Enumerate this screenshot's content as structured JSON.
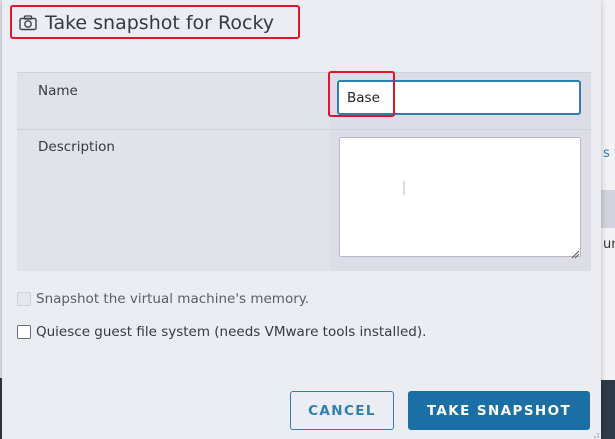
{
  "dialog": {
    "title": "Take snapshot for Rocky",
    "title_icon": "camera-icon"
  },
  "form": {
    "name_label": "Name",
    "name_value": "Base",
    "description_label": "Description",
    "description_value": ""
  },
  "options": {
    "memory_label": "Snapshot the virtual machine's memory.",
    "memory_checked": false,
    "memory_disabled": true,
    "quiesce_label": "Quiesce guest file system (needs VMware tools installed).",
    "quiesce_checked": false
  },
  "buttons": {
    "cancel_label": "CANCEL",
    "take_label": "TAKE SNAPSHOT"
  },
  "background": {
    "fragment_1": "s v",
    "fragment_2": "ur"
  },
  "colors": {
    "accent": "#1c6fa5",
    "highlight": "#e0142c"
  }
}
